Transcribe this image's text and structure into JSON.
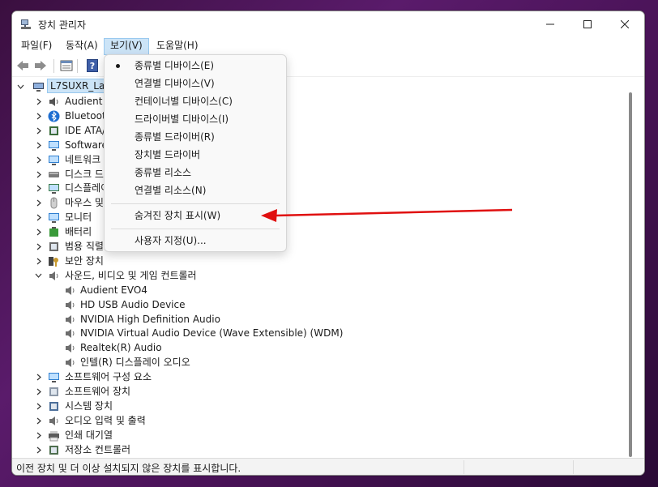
{
  "window": {
    "title": "장치 관리자",
    "controls": [
      "minimize-icon",
      "maximize-icon",
      "close-icon"
    ]
  },
  "menubar": [
    "파일(F)",
    "동작(A)",
    "보기(V)",
    "도움말(H)"
  ],
  "view_menu": {
    "items": [
      {
        "label": "종류별 디바이스(E)",
        "checked": true
      },
      {
        "label": "연결별 디바이스(V)"
      },
      {
        "label": "컨테이너별 디바이스(C)"
      },
      {
        "label": "드라이버별 디바이스(I)"
      },
      {
        "label": "종류별 드라이버(R)"
      },
      {
        "label": "장치별 드라이버"
      },
      {
        "label": "종류별 리소스"
      },
      {
        "label": "연결별 리소스(N)"
      }
    ],
    "show_hidden": "숨겨진 장치 표시(W)",
    "customize": "사용자 지정(U)..."
  },
  "tree": {
    "root": "L7SUXR_Lapt",
    "categories": [
      {
        "label": "Audient USB Audio",
        "icon": "audio-device-icon"
      },
      {
        "label": "Bluetooth",
        "icon": "bluetooth-icon"
      },
      {
        "label": "IDE ATA/ATAPI 컨트롤러",
        "icon": "ide-controller-icon"
      },
      {
        "label": "Software components",
        "icon": "software-component-icon"
      },
      {
        "label": "네트워크 어댑터",
        "icon": "network-adapter-icon"
      },
      {
        "label": "디스크 드라이브",
        "icon": "disk-drive-icon"
      },
      {
        "label": "디스플레이 어댑터",
        "icon": "display-adapter-icon"
      },
      {
        "label": "마우스 및 기타 포인팅 장치",
        "icon": "mouse-icon"
      },
      {
        "label": "모니터",
        "icon": "monitor-icon"
      },
      {
        "label": "배터리",
        "icon": "battery-icon"
      },
      {
        "label": "범용 직렬 버스 컨트롤러",
        "icon": "usb-controller-icon"
      },
      {
        "label": "보안 장치",
        "icon": "security-device-icon"
      }
    ],
    "sound": {
      "label": "사운드, 비디오 및 게임 컨트롤러",
      "icon": "speaker-icon",
      "children": [
        "Audient EVO4",
        "HD USB Audio Device",
        "NVIDIA High Definition Audio",
        "NVIDIA Virtual Audio Device (Wave Extensible) (WDM)",
        "Realtek(R) Audio",
        "인텔(R) 디스플레이 오디오"
      ]
    },
    "after": [
      {
        "label": "소프트웨어 구성 요소",
        "icon": "software-component-icon"
      },
      {
        "label": "소프트웨어 장치",
        "icon": "software-device-icon"
      },
      {
        "label": "시스템 장치",
        "icon": "system-device-icon"
      },
      {
        "label": "오디오 입력 및 출력",
        "icon": "audio-io-icon"
      },
      {
        "label": "인쇄 대기열",
        "icon": "printer-icon"
      },
      {
        "label": "저장소 컨트롤러",
        "icon": "storage-controller-icon"
      }
    ]
  },
  "statusbar": {
    "text": "이전 장치 및 더 이상 설치되지 않은 장치를 표시합니다."
  },
  "colors": {
    "annotation_arrow": "#e01010",
    "menu_highlight": "#cce4f7"
  }
}
